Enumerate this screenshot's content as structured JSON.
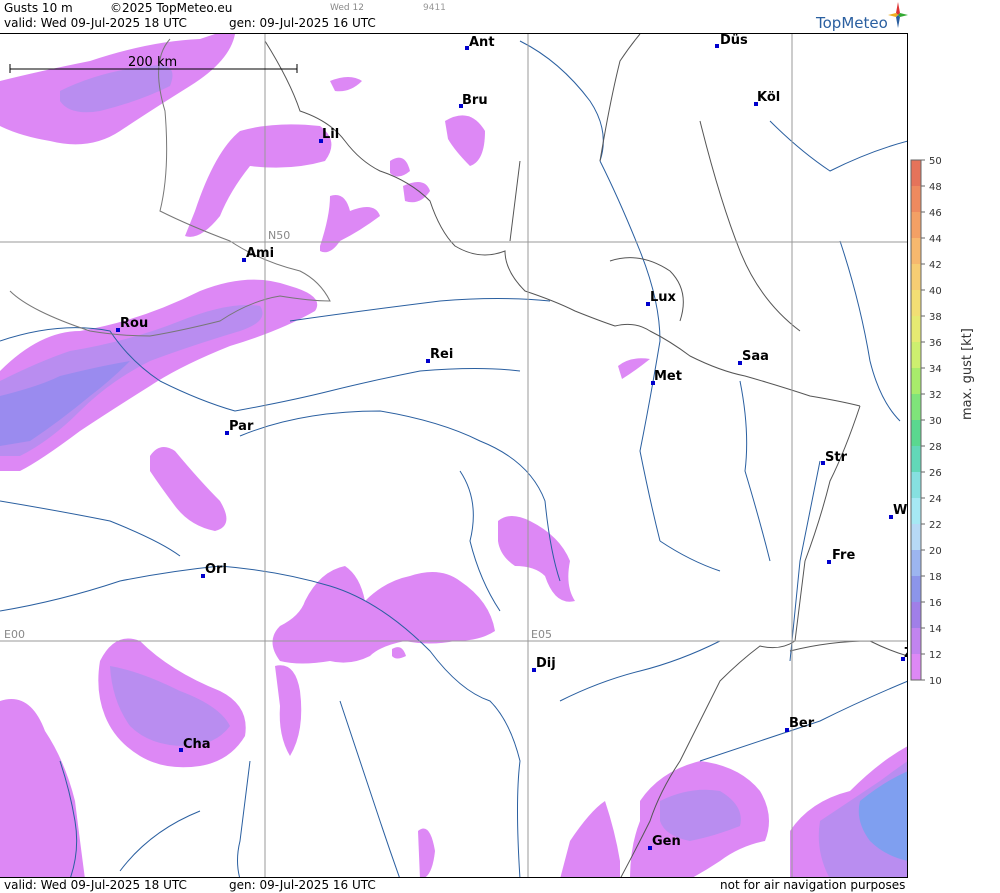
{
  "header": {
    "product": "Gusts 10 m",
    "copyright": "©2025 TopMeteo.eu",
    "day_tag": "Wed 12",
    "code": "9411",
    "valid": "valid:  Wed  09-Jul-2025  18 UTC",
    "generated": "gen:  09-Jul-2025 16 UTC",
    "brand": "TopMeteo"
  },
  "map": {
    "scale_label": "200 km",
    "grid_labels": {
      "lat": "N50",
      "lon_west": "E00",
      "lon_east": "E05"
    },
    "cities": [
      {
        "id": "ant",
        "name": "Ant"
      },
      {
        "id": "dus",
        "name": "Düs"
      },
      {
        "id": "bru",
        "name": "Bru"
      },
      {
        "id": "kol",
        "name": "Köl"
      },
      {
        "id": "lil",
        "name": "Lil"
      },
      {
        "id": "ami",
        "name": "Ami"
      },
      {
        "id": "lux",
        "name": "Lux"
      },
      {
        "id": "rou",
        "name": "Rou"
      },
      {
        "id": "rei",
        "name": "Rei"
      },
      {
        "id": "saa",
        "name": "Saa"
      },
      {
        "id": "met",
        "name": "Met"
      },
      {
        "id": "par",
        "name": "Par"
      },
      {
        "id": "str",
        "name": "Str"
      },
      {
        "id": "w",
        "name": "W"
      },
      {
        "id": "fre",
        "name": "Fre"
      },
      {
        "id": "orl",
        "name": "Orl"
      },
      {
        "id": "dij",
        "name": "Dij"
      },
      {
        "id": "ber",
        "name": "Ber"
      },
      {
        "id": "cha",
        "name": "Cha"
      },
      {
        "id": "gen",
        "name": "Gen"
      },
      {
        "id": "z",
        "name": "Z"
      }
    ]
  },
  "legend": {
    "title": "max. gust [kt]",
    "unit": "kt",
    "range": [
      12,
      50
    ],
    "labels": [
      "50",
      "48",
      "46",
      "44",
      "42",
      "40",
      "38",
      "36",
      "34",
      "32",
      "30",
      "28",
      "26",
      "24",
      "22",
      "20",
      "18",
      "16",
      "14",
      "12",
      "10"
    ],
    "colors": [
      "#e5735a",
      "#ee8a5f",
      "#f3a065",
      "#f7b86e",
      "#f7cd73",
      "#f2de74",
      "#e6ea72",
      "#cdef6f",
      "#a8ec6b",
      "#7fe47a",
      "#5ad88f",
      "#62d8b8",
      "#86e0e0",
      "#a6e8f4",
      "#b7d9f6",
      "#9cb5f0",
      "#8c95ea",
      "#a07fe8",
      "#c184ef",
      "#dd88f5"
    ],
    "gust_colors": {
      "light": "#dd88f5",
      "mid": "#b98df0",
      "strong": "#9a8bef",
      "blue": "#7f9ff0"
    }
  },
  "footer": {
    "valid": "valid:  Wed  09-Jul-2025  18 UTC",
    "generated": "gen:  09-Jul-2025 16 UTC",
    "disclaimer": "not for air navigation purposes"
  }
}
